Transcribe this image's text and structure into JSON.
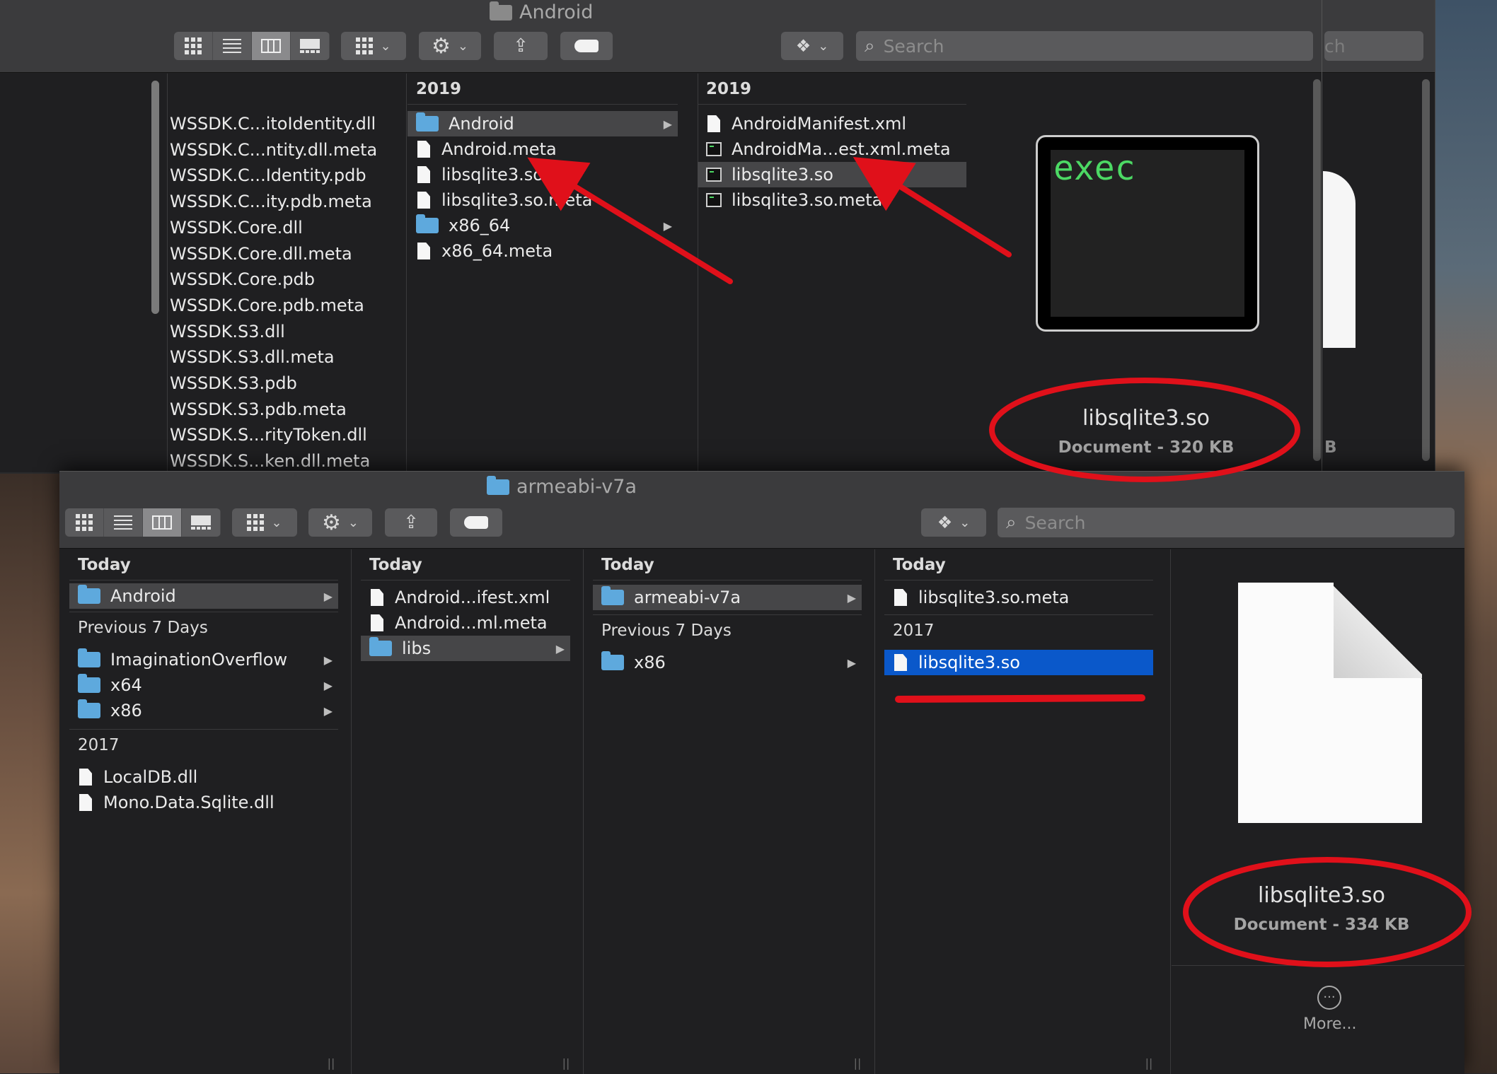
{
  "top_window": {
    "title": "Android",
    "search_placeholder": "Search",
    "partial_search_text": "ch",
    "partial_info_text": "B",
    "col1_rows": [
      "WSSDK.C...itoIdentity.dll",
      "WSSDK.C...ntity.dll.meta",
      "WSSDK.C...Identity.pdb",
      "WSSDK.C...ity.pdb.meta",
      "WSSDK.Core.dll",
      "WSSDK.Core.dll.meta",
      "WSSDK.Core.pdb",
      "WSSDK.Core.pdb.meta",
      "WSSDK.S3.dll",
      "WSSDK.S3.dll.meta",
      "WSSDK.S3.pdb",
      "WSSDK.S3.pdb.meta",
      "WSSDK.S...rityToken.dll",
      "WSSDK.S...ken.dll.meta"
    ],
    "col2": {
      "header": "2019",
      "rows": [
        {
          "name": "Android",
          "kind": "folder"
        },
        {
          "name": "Android.meta",
          "kind": "doc"
        },
        {
          "name": "libsqlite3.so",
          "kind": "doc"
        },
        {
          "name": "libsqlite3.so.meta",
          "kind": "doc"
        },
        {
          "name": "x86_64",
          "kind": "folder"
        },
        {
          "name": "x86_64.meta",
          "kind": "doc"
        }
      ]
    },
    "col3": {
      "header": "2019",
      "rows": [
        {
          "name": "AndroidManifest.xml",
          "kind": "doc"
        },
        {
          "name": "AndroidMa...est.xml.meta",
          "kind": "exec"
        },
        {
          "name": "libsqlite3.so",
          "kind": "exec"
        },
        {
          "name": "libsqlite3.so.meta",
          "kind": "exec"
        }
      ]
    },
    "preview": {
      "icon_text": "exec",
      "name": "libsqlite3.so",
      "info": "Document - 320 KB"
    }
  },
  "bottom_window": {
    "title": "armeabi-v7a",
    "search_placeholder": "Search",
    "col1": {
      "header": "Today",
      "today_rows": [
        "Android"
      ],
      "group2": "Previous 7 Days",
      "group2_rows": [
        "ImaginationOverflow",
        "x64",
        "x86"
      ],
      "group3": "2017",
      "group3_rows": [
        "LocalDB.dll",
        "Mono.Data.Sqlite.dll"
      ]
    },
    "col2": {
      "header": "Today",
      "rows": [
        "Android...ifest.xml",
        "Android...ml.meta",
        "libs"
      ]
    },
    "col3": {
      "header": "Today",
      "today_rows": [
        "armeabi-v7a"
      ],
      "group2": "Previous 7 Days",
      "group2_rows": [
        "x86"
      ]
    },
    "col4": {
      "header": "Today",
      "today_rows": [
        "libsqlite3.so.meta"
      ],
      "group2": "2017",
      "group2_rows": [
        "libsqlite3.so"
      ]
    },
    "preview": {
      "name": "libsqlite3.so",
      "info": "Document - 334 KB",
      "more_label": "More..."
    }
  },
  "colors": {
    "annotation_red": "#e0101a",
    "selection_blue": "#0a58ca",
    "folder_blue": "#5ea9dd",
    "exec_green": "#4cd964"
  },
  "icons": {
    "view_icons": "icon-view-icon",
    "view_list": "list-view-icon",
    "view_columns": "column-view-icon",
    "view_gallery": "gallery-view-icon",
    "group": "group-by-icon",
    "action": "gear-icon",
    "share": "share-icon",
    "tags": "tag-icon",
    "dropbox": "dropbox-icon",
    "search": "magnifier-icon"
  }
}
